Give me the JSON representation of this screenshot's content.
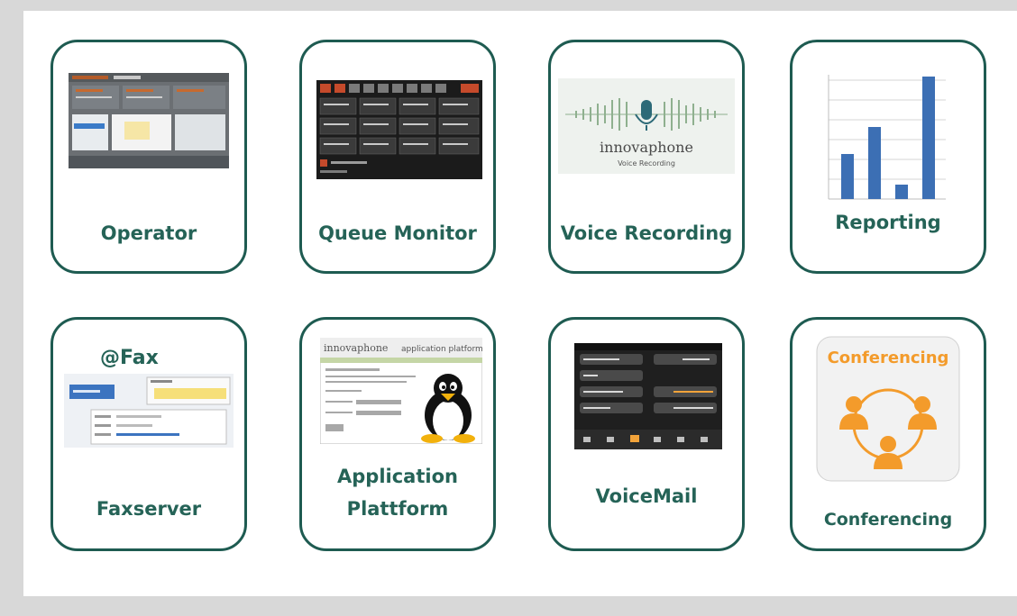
{
  "apps": [
    {
      "id": "operator",
      "label": "Operator",
      "icon": "operator-screenshot-icon"
    },
    {
      "id": "queue-monitor",
      "label": "Queue Monitor",
      "icon": "queue-monitor-screenshot-icon"
    },
    {
      "id": "voice-recording",
      "label": "Voice Recording",
      "icon": "voice-recording-logo-icon",
      "logo_brand": "innovaphone",
      "logo_caption": "Voice Recording"
    },
    {
      "id": "reporting",
      "label": "Reporting",
      "icon": "bar-chart-icon"
    },
    {
      "id": "faxserver",
      "label": "Faxserver",
      "icon": "fax-screenshot-icon",
      "heading": "@Fax"
    },
    {
      "id": "application-platform",
      "label_line1": "Application",
      "label_line2": "Plattform",
      "icon": "linux-penguin-icon",
      "logo_brand": "innovaphone",
      "logo_caption": "application platform"
    },
    {
      "id": "voicemail",
      "label": "VoiceMail",
      "icon": "voicemail-phone-screenshot-icon"
    },
    {
      "id": "conferencing",
      "label": "Conferencing",
      "icon": "conferencing-people-icon",
      "icon_caption": "Conferencing"
    }
  ],
  "colors": {
    "tile_border": "#1e5b51",
    "label": "#256357",
    "conference_orange": "#f39b2b",
    "chart_bar": "#3c6fb4"
  }
}
